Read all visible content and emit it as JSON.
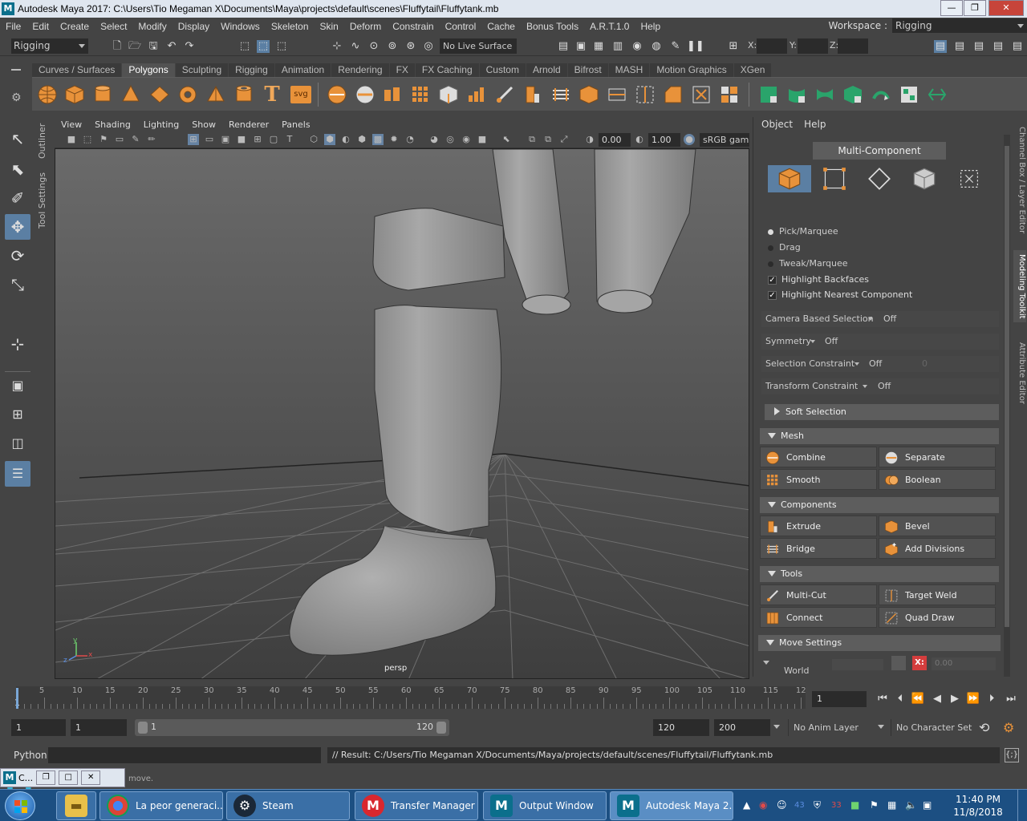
{
  "window": {
    "title": "Autodesk Maya 2017: C:\\Users\\Tio Megaman X\\Documents\\Maya\\projects\\default\\scenes\\Fluffytail\\Fluffytank.mb",
    "icon_letter": "M",
    "controls": {
      "minimize": "—",
      "restore": "❐",
      "close": "✕"
    }
  },
  "menubar": {
    "items": [
      "File",
      "Edit",
      "Create",
      "Select",
      "Modify",
      "Display",
      "Windows",
      "Skeleton",
      "Skin",
      "Deform",
      "Constrain",
      "Control",
      "Cache",
      "Bonus Tools",
      "A.R.T.1.0",
      "Help"
    ],
    "workspace_label": "Workspace :",
    "workspace_value": "Rigging"
  },
  "statusline": {
    "mode": "Rigging",
    "live_surface": "No Live Surface",
    "x_label": "X:",
    "y_label": "Y:",
    "z_label": "Z:"
  },
  "shelf": {
    "tabs": [
      "Curves / Surfaces",
      "Polygons",
      "Sculpting",
      "Rigging",
      "Animation",
      "Rendering",
      "FX",
      "FX Caching",
      "Custom",
      "Arnold",
      "Bifrost",
      "MASH",
      "Motion Graphics",
      "XGen"
    ],
    "active_tab": "Polygons",
    "text_icon": "T",
    "svg_icon": "svg"
  },
  "side_labels": {
    "outliner": "Outliner",
    "tool_settings": "Tool Settings"
  },
  "viewport": {
    "menu": [
      "View",
      "Shading",
      "Lighting",
      "Show",
      "Renderer",
      "Panels"
    ],
    "exposure": "0.00",
    "gamma": "1.00",
    "color_space": "sRGB gamma",
    "camera_label": "persp",
    "axis_y": "y",
    "axis_x": "x",
    "axis_z": "z"
  },
  "modeling_toolkit": {
    "menu": [
      "Object",
      "Help"
    ],
    "mode_button": "Multi-Component",
    "radios": [
      {
        "label": "Pick/Marquee",
        "on": true
      },
      {
        "label": "Drag",
        "on": false
      },
      {
        "label": "Tweak/Marquee",
        "on": false
      }
    ],
    "checks": [
      {
        "label": "Highlight Backfaces",
        "mark": "✓"
      },
      {
        "label": "Highlight Nearest Component",
        "mark": "✓"
      }
    ],
    "options": [
      {
        "label": "Camera Based Selection",
        "value": "Off"
      },
      {
        "label": "Symmetry",
        "value": "Off"
      },
      {
        "label": "Selection Constraint",
        "value": "Off",
        "extra": "0"
      },
      {
        "label": "Transform Constraint",
        "value": "Off"
      }
    ],
    "soft_selection": "Soft Selection",
    "sections": {
      "mesh": {
        "title": "Mesh",
        "buttons": [
          "Combine",
          "Separate",
          "Smooth",
          "Boolean"
        ]
      },
      "components": {
        "title": "Components",
        "buttons": [
          "Extrude",
          "Bevel",
          "Bridge",
          "Add Divisions"
        ]
      },
      "tools": {
        "title": "Tools",
        "buttons": [
          "Multi-Cut",
          "Target Weld",
          "Connect",
          "Quad Draw"
        ]
      }
    },
    "move_settings": "Move Settings",
    "world_label": "World",
    "x_badge": "X:",
    "x_value": "0.00"
  },
  "side_tabs": [
    "Channel Box / Layer Editor",
    "Modeling Toolkit",
    "Attribute Editor"
  ],
  "timeline": {
    "ticks": [
      "5",
      "10",
      "15",
      "20",
      "25",
      "30",
      "35",
      "40",
      "45",
      "50",
      "55",
      "60",
      "65",
      "70",
      "75",
      "80",
      "85",
      "90",
      "95",
      "100",
      "105",
      "110",
      "115",
      "12"
    ],
    "start_label": "1",
    "current_frame": "1"
  },
  "range": {
    "start": "1",
    "playback_start": "1",
    "slider_start": "1",
    "slider_end": "120",
    "playback_end": "120",
    "end": "200",
    "anim_layer": "No Anim Layer",
    "character_set": "No Character Set"
  },
  "commandline": {
    "language": "Python",
    "result": "// Result: C:/Users/Tio Megaman X/Documents/Maya/projects/default/scenes/Fluffytail/Fluffytank.mb"
  },
  "helpline": {
    "text": "move.",
    "mini_window_title": "C..."
  },
  "taskbar": {
    "items": [
      {
        "label": "La peor generaci...",
        "icon": "chrome-icon"
      },
      {
        "label": "Steam",
        "icon": "steam-icon"
      },
      {
        "label": "Transfer Manager",
        "icon": "mega-icon"
      },
      {
        "label": "Output Window",
        "icon": "maya-icon"
      },
      {
        "label": "Autodesk Maya 2...",
        "icon": "maya-icon"
      }
    ],
    "tray_text_1": "43",
    "tray_text_2": "33",
    "time": "11:40 PM",
    "date": "11/8/2018"
  }
}
